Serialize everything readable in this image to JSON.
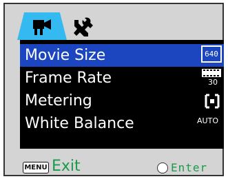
{
  "tabs": [
    {
      "name": "movie",
      "icon": "video-camera-icon",
      "active": true
    },
    {
      "name": "settings",
      "icon": "tools-icon",
      "active": false
    }
  ],
  "menu": {
    "items": [
      {
        "label": "Movie Size",
        "value": "640",
        "selected": true
      },
      {
        "label": "Frame Rate",
        "value": "30",
        "selected": false
      },
      {
        "label": "Metering",
        "value": "",
        "icon": "center-metering-icon",
        "selected": false
      },
      {
        "label": "White Balance",
        "value": "AUTO",
        "selected": false
      }
    ]
  },
  "footer": {
    "menu_key": "MENU",
    "exit_label": "Exit",
    "enter_label": "Enter"
  },
  "colors": {
    "active_tab": "#35b9f1",
    "selection": "#1b46c0",
    "hint_text": "#1a9a4a"
  }
}
